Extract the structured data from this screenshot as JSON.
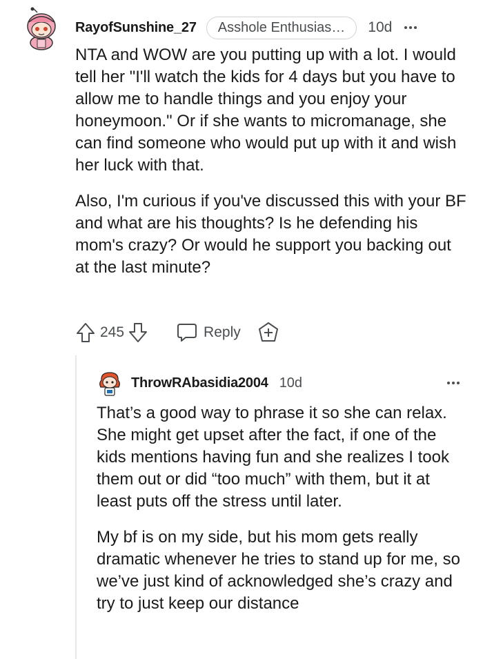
{
  "comment": {
    "author": "RayofSunshine_27",
    "flair": "Asshole Enthusias…",
    "age": "10d",
    "paragraphs": [
      "NTA and WOW are you putting up with a lot. I would tell her \"I'll watch the kids for 4 days but you have to allow me to handle things and you enjoy your honeymoon.\" Or if she wants to micromanage, she can find someone who would put up with it and wish her luck with that.",
      "Also, I'm curious if you've discussed this with your BF and what are his thoughts? Is he defending his mom's crazy? Or would he support you backing out at the last minute?"
    ],
    "votes": "245",
    "reply_label": "Reply",
    "icons": {
      "more": "more-icon",
      "upvote": "upvote-icon",
      "downvote": "downvote-icon",
      "reply": "comment-bubble-icon",
      "award": "award-plus-icon"
    },
    "colors": {
      "text": "#1a1a1b",
      "meta": "#4a4d50",
      "avatar_pink": "#f4a7b9"
    }
  },
  "reply": {
    "author": "ThrowRAbasidia2004",
    "age": "10d",
    "paragraphs": [
      "That’s a good way to phrase it so she can relax. She might get upset after the fact, if one of the kids mentions having fun and she realizes I took them out or did “too much” with them, but it at least puts off the stress until later.",
      "My bf is on my side, but his mom gets really dramatic whenever he tries to stand up for me, so we’ve just kind of acknowledged she’s crazy and try to just keep our distance"
    ],
    "colors": {
      "avatar_hair": "#e0532b"
    }
  }
}
